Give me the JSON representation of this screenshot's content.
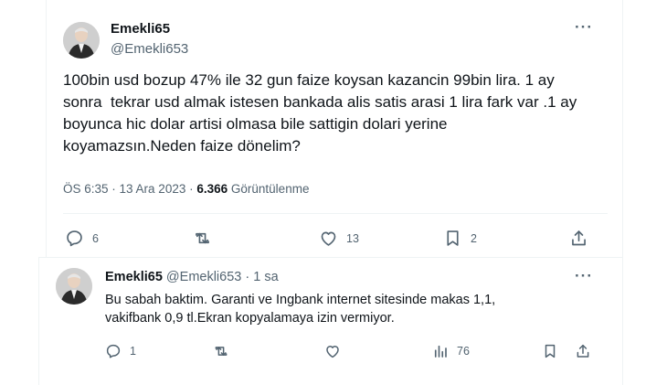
{
  "main_tweet": {
    "display_name": "Emekli65",
    "handle": "@Emekli653",
    "more_label": "···",
    "text": "100bin usd bozup 47% ile 32 gun faize koysan kazancin 99bin lira. 1 ay\nsonra  tekrar usd almak istesen bankada alis satis arasi 1 lira fark var .1 ay\nboyunca hic dolar artisi olmasa bile sattigin dolari yerine\nkoyamazsın.Neden faize dönelim?",
    "time": "ÖS 6:35",
    "separator": " · ",
    "date": "13 Ara 2023",
    "views_count": "6.366",
    "views_label": " Görüntülenme",
    "actions": {
      "replies": "6",
      "reposts": "",
      "likes": "13",
      "bookmarks": "2"
    }
  },
  "reply_tweet": {
    "display_name": "Emekli65",
    "handle": "@Emekli653",
    "time_ago": "1 sa",
    "dot": " · ",
    "more_label": "···",
    "text": "Bu sabah baktim. Garanti ve Ingbank internet sitesinde makas 1,1,\nvakifbank 0,9 tl.Ekran kopyalamaya izin vermiyor.",
    "actions": {
      "replies": "1",
      "reposts": "",
      "likes": "",
      "views": "76"
    }
  },
  "icons": [
    "reply-icon",
    "repost-icon",
    "like-icon",
    "bookmark-icon",
    "share-icon",
    "views-icon",
    "more-icon"
  ],
  "colors": {
    "text": "#0f1419",
    "secondary": "#536471",
    "border": "#eff3f4"
  }
}
